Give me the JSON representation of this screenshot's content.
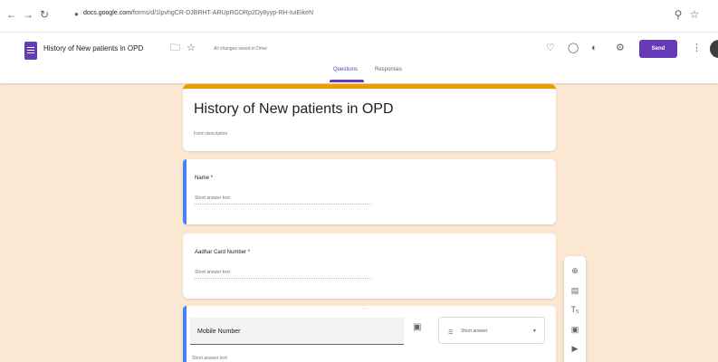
{
  "browser": {
    "url_host": "docs.google.com",
    "url_path": "/forms/d/1lpvhgCR-DJBRHT-ARUpRGDRp2Dy8yyp-RH-IuiEikeN"
  },
  "app": {
    "title": "History of New patients in OPD",
    "saved_status": "All changes saved in Drive",
    "send_label": "Send"
  },
  "tabs": [
    {
      "label": "Questions"
    },
    {
      "label": "Responses"
    }
  ],
  "form": {
    "title": "History of New patients in OPD",
    "description": "Form description"
  },
  "questions": [
    {
      "label": "Name *",
      "answer_placeholder": "Short answer text"
    },
    {
      "label": "Aadhar Card Number *",
      "answer_placeholder": "Short answer text"
    },
    {
      "label": "Mobile Number",
      "answer_placeholder": "Short answer text",
      "type": "Short answer"
    }
  ],
  "colors": {
    "accent": "#673ab7",
    "header_bar": "#f29900",
    "active_question": "#4285f4",
    "background": "#fbe8d3"
  },
  "icons": {
    "toolbar": [
      "add-question-icon",
      "import-questions-icon",
      "add-title-icon",
      "add-image-icon",
      "add-video-icon"
    ]
  }
}
